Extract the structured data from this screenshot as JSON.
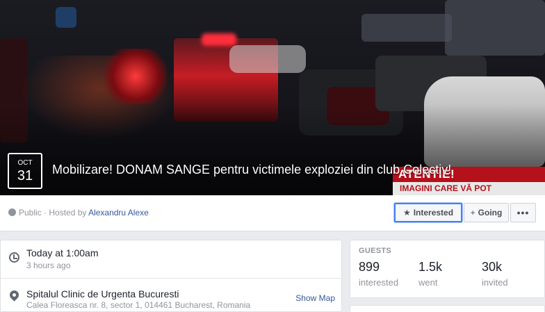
{
  "cover": {
    "date_month": "OCT",
    "date_day": "31",
    "title": "Mobilizare! DONAM SANGE pentru victimele exploziei din club Colectiv!",
    "tv_banner_top": "ATENTIE!",
    "tv_banner_sub": "IMAGINI CARE VĂ POT"
  },
  "action_bar": {
    "privacy": "Public",
    "hosted_by_prefix": "· Hosted by",
    "host_name": "Alexandru Alexe",
    "interested_label": "Interested",
    "going_label": "Going",
    "more_label": "•••",
    "icons": {
      "privacy": "globe-icon",
      "interested": "star-icon",
      "going": "plus-icon",
      "more": "more-icon"
    }
  },
  "details": {
    "time_title": "Today at 1:00am",
    "time_sub": "3 hours ago",
    "place_title": "Spitalul Clinic de Urgenta Bucuresti",
    "place_address": "Calea Floreasca nr. 8, sector 1, 014461 Bucharest, Romania",
    "show_map": "Show Map",
    "icons": {
      "time": "clock-icon",
      "place": "map-pin-icon"
    }
  },
  "guests": {
    "label": "GUESTS",
    "stats": [
      {
        "value": "899",
        "label": "interested"
      },
      {
        "value": "1.5k",
        "label": "went"
      },
      {
        "value": "30k",
        "label": "invited"
      }
    ]
  },
  "colors": {
    "link": "#365899",
    "accent": "#4080ff",
    "background": "#e9ebee"
  }
}
